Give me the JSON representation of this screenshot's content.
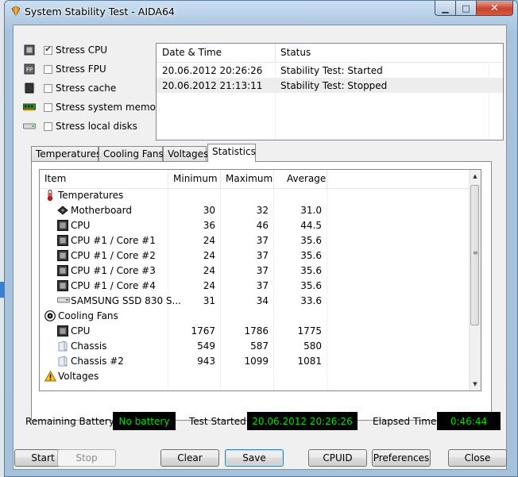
{
  "window": {
    "title": "System Stability Test - AIDA64",
    "min_glyph": "▁",
    "max_glyph": "□",
    "close_glyph": "✕"
  },
  "stress_options": [
    {
      "label": "Stress CPU",
      "checked": true,
      "icon": "cpu-chip-icon"
    },
    {
      "label": "Stress FPU",
      "checked": false,
      "icon": "fpu-chip-icon"
    },
    {
      "label": "Stress cache",
      "checked": false,
      "icon": "cache-chip-icon"
    },
    {
      "label": "Stress system memory",
      "checked": false,
      "icon": "memory-module-icon"
    },
    {
      "label": "Stress local disks",
      "checked": false,
      "icon": "hard-disk-icon"
    }
  ],
  "log": {
    "headers": {
      "date": "Date & Time",
      "status": "Status"
    },
    "rows": [
      {
        "date": "20.06.2012 20:26:26",
        "status": "Stability Test: Started"
      },
      {
        "date": "20.06.2012 21:13:11",
        "status": "Stability Test: Stopped"
      }
    ]
  },
  "tabs": [
    "Temperatures",
    "Cooling Fans",
    "Voltages",
    "Statistics"
  ],
  "active_tab": "Statistics",
  "stats": {
    "headers": {
      "item": "Item",
      "min": "Minimum",
      "max": "Maximum",
      "avg": "Average"
    },
    "rows": [
      {
        "kind": "group",
        "label": "Temperatures",
        "icon": "thermometer-icon"
      },
      {
        "kind": "item",
        "label": "Motherboard",
        "min": "30",
        "max": "32",
        "avg": "31.0",
        "icon": "motherboard-icon"
      },
      {
        "kind": "item",
        "label": "CPU",
        "min": "36",
        "max": "46",
        "avg": "44.5",
        "icon": "cpu-icon"
      },
      {
        "kind": "item",
        "label": "CPU #1 / Core #1",
        "min": "24",
        "max": "37",
        "avg": "35.6",
        "icon": "cpu-core-icon"
      },
      {
        "kind": "item",
        "label": "CPU #1 / Core #2",
        "min": "24",
        "max": "37",
        "avg": "35.6",
        "icon": "cpu-core-icon"
      },
      {
        "kind": "item",
        "label": "CPU #1 / Core #3",
        "min": "24",
        "max": "37",
        "avg": "35.6",
        "icon": "cpu-core-icon"
      },
      {
        "kind": "item",
        "label": "CPU #1 / Core #4",
        "min": "24",
        "max": "37",
        "avg": "35.6",
        "icon": "cpu-core-icon"
      },
      {
        "kind": "item",
        "label": "SAMSUNG SSD 830 S...",
        "min": "31",
        "max": "34",
        "avg": "33.6",
        "icon": "disk-icon"
      },
      {
        "kind": "group",
        "label": "Cooling Fans",
        "icon": "fan-icon"
      },
      {
        "kind": "item",
        "label": "CPU",
        "min": "1767",
        "max": "1786",
        "avg": "1775",
        "icon": "cpu-icon"
      },
      {
        "kind": "item",
        "label": "Chassis",
        "min": "549",
        "max": "587",
        "avg": "580",
        "icon": "chassis-icon"
      },
      {
        "kind": "item",
        "label": "Chassis #2",
        "min": "943",
        "max": "1099",
        "avg": "1081",
        "icon": "chassis-icon"
      },
      {
        "kind": "group",
        "label": "Voltages",
        "icon": "warning-icon"
      }
    ]
  },
  "status_bar": {
    "battery_label": "Remaining Battery:",
    "battery_value": "No battery",
    "started_label": "Test Started:",
    "started_value": "20.06.2012 20:26:26",
    "elapsed_label": "Elapsed Time:",
    "elapsed_value": "0:46:44"
  },
  "buttons": {
    "start": "Start",
    "stop": "Stop",
    "clear": "Clear",
    "save": "Save",
    "cpuid": "CPUID",
    "preferences": "Preferences",
    "close": "Close"
  },
  "colors": {
    "status_box_bg": "#000000",
    "status_box_text": "#00e000",
    "close_button": "#c7432d",
    "aero_frame": "#a9c3de"
  }
}
